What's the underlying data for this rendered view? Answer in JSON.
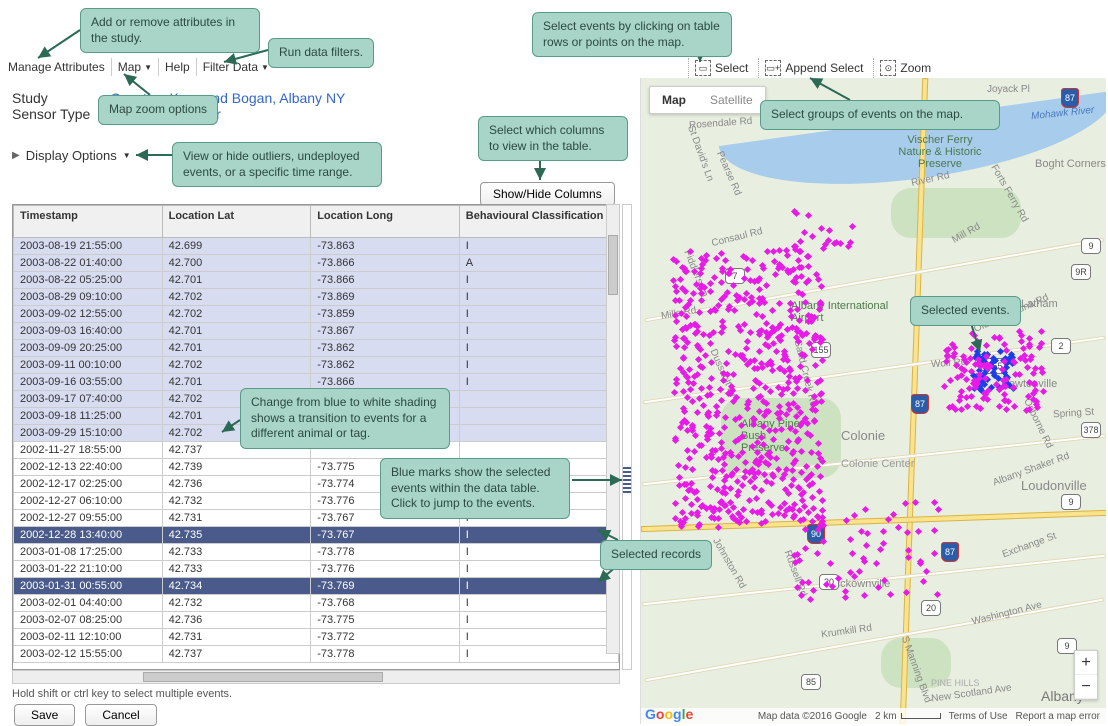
{
  "callouts": {
    "add_remove": "Add or remove attributes in the study.",
    "map_zoom": "Map zoom options",
    "run_filters": "Run data filters.",
    "display_opts": "View or hide outliers, undeployed events, or a specific time range.",
    "select_columns": "Select which columns to view in the table.",
    "shading_change": "Change from blue to white shading shows a transition to events for a different animal or tag.",
    "blue_marks": "Blue marks show the selected events within the data table. Click to jump to the events.",
    "selected_records": "Selected records",
    "select_events": "Select events by clicking on table rows or points on the map.",
    "select_groups": "Select groups of events on the map.",
    "selected_events": "Selected events."
  },
  "menubar": {
    "manage_attributes": "Manage Attributes",
    "map": "Map",
    "help": "Help",
    "filter_data": "Filter Data"
  },
  "study": {
    "label_study": "Study",
    "label_sensor": "Sensor Type",
    "value_study": "Coyotes, Kays and Bogan, Albany NY",
    "value_sensor": "Radio Transmitter"
  },
  "display_options": "Display Options",
  "showhide": "Show/Hide Columns",
  "columns": {
    "timestamp": "Timestamp",
    "lat": "Location Lat",
    "long": "Location Long",
    "behav": "Behavioural Classification"
  },
  "rows": [
    {
      "ts": "2003-08-19 21:55:00",
      "lat": "42.699",
      "lon": "-73.863",
      "b": "I",
      "shade": true
    },
    {
      "ts": "2003-08-22 01:40:00",
      "lat": "42.700",
      "lon": "-73.866",
      "b": "A",
      "shade": true
    },
    {
      "ts": "2003-08-22 05:25:00",
      "lat": "42.701",
      "lon": "-73.866",
      "b": "I",
      "shade": true
    },
    {
      "ts": "2003-08-29 09:10:00",
      "lat": "42.702",
      "lon": "-73.869",
      "b": "I",
      "shade": true
    },
    {
      "ts": "2003-09-02 12:55:00",
      "lat": "42.702",
      "lon": "-73.859",
      "b": "I",
      "shade": true
    },
    {
      "ts": "2003-09-03 16:40:00",
      "lat": "42.701",
      "lon": "-73.867",
      "b": "I",
      "shade": true
    },
    {
      "ts": "2003-09-09 20:25:00",
      "lat": "42.701",
      "lon": "-73.862",
      "b": "I",
      "shade": true
    },
    {
      "ts": "2003-09-11 00:10:00",
      "lat": "42.702",
      "lon": "-73.862",
      "b": "I",
      "shade": true
    },
    {
      "ts": "2003-09-16 03:55:00",
      "lat": "42.701",
      "lon": "-73.866",
      "b": "I",
      "shade": true
    },
    {
      "ts": "2003-09-17 07:40:00",
      "lat": "42.702",
      "lon": "",
      "b": "",
      "shade": true
    },
    {
      "ts": "2003-09-18 11:25:00",
      "lat": "42.701",
      "lon": "",
      "b": "",
      "shade": true
    },
    {
      "ts": "2003-09-29 15:10:00",
      "lat": "42.702",
      "lon": "",
      "b": "",
      "shade": true
    },
    {
      "ts": "2002-11-27 18:55:00",
      "lat": "42.737",
      "lon": "",
      "b": "",
      "shade": false
    },
    {
      "ts": "2002-12-13 22:40:00",
      "lat": "42.739",
      "lon": "-73.775",
      "b": "",
      "shade": false
    },
    {
      "ts": "2002-12-17 02:25:00",
      "lat": "42.736",
      "lon": "-73.774",
      "b": "",
      "shade": false
    },
    {
      "ts": "2002-12-27 06:10:00",
      "lat": "42.732",
      "lon": "-73.776",
      "b": "I",
      "shade": false
    },
    {
      "ts": "2002-12-27 09:55:00",
      "lat": "42.731",
      "lon": "-73.767",
      "b": "I",
      "shade": false
    },
    {
      "ts": "2002-12-28 13:40:00",
      "lat": "42.735",
      "lon": "-73.767",
      "b": "I",
      "shade": false,
      "selected": true
    },
    {
      "ts": "2003-01-08 17:25:00",
      "lat": "42.733",
      "lon": "-73.778",
      "b": "I",
      "shade": false
    },
    {
      "ts": "2003-01-22 21:10:00",
      "lat": "42.733",
      "lon": "-73.776",
      "b": "I",
      "shade": false
    },
    {
      "ts": "2003-01-31 00:55:00",
      "lat": "42.734",
      "lon": "-73.769",
      "b": "I",
      "shade": false,
      "selected": true
    },
    {
      "ts": "2003-02-01 04:40:00",
      "lat": "42.732",
      "lon": "-73.768",
      "b": "I",
      "shade": false
    },
    {
      "ts": "2003-02-07 08:25:00",
      "lat": "42.736",
      "lon": "-73.775",
      "b": "I",
      "shade": false
    },
    {
      "ts": "2003-02-11 12:10:00",
      "lat": "42.731",
      "lon": "-73.772",
      "b": "I",
      "shade": false
    },
    {
      "ts": "2003-02-12 15:55:00",
      "lat": "42.737",
      "lon": "-73.778",
      "b": "I",
      "shade": false
    }
  ],
  "hint": "Hold shift or ctrl key to select multiple events.",
  "buttons": {
    "save": "Save",
    "cancel": "Cancel"
  },
  "maptools": {
    "select": "Select",
    "append": "Append Select",
    "zoom": "Zoom"
  },
  "maptype": {
    "map": "Map",
    "sat": "Satellite"
  },
  "map_labels": {
    "vischer": "Vischer Ferry Nature & Historic Preserve",
    "boght": "Boght Corners",
    "airport": "Albany International Airport",
    "colonie": "Colonie",
    "coloniectr": "Colonie Center",
    "mckown": "Mckownville",
    "loudon": "Loudonville",
    "newton": "Newtonville",
    "albany": "Albany",
    "pinehills": "PINE HILLS",
    "latham": "Latham",
    "bushpine": "Albany Pine Bush Preserve",
    "rd1": "Rosendale Rd",
    "rd2": "Consaul Rd",
    "rd3": "Wolf Rd",
    "rd4": "Albany Shaker Rd",
    "rd5": "Exchange St",
    "rd6": "Washington Ave",
    "rd7": "New Scotland Ave",
    "rd8": "Forts Ferry Rd",
    "rd9": "Mill Rd",
    "rd10": "Old Niskayuna Rd",
    "rd11": "Spring St",
    "rd12": "River Rd",
    "rd13": "Johnston Rd",
    "rd14": "Russell Rd",
    "rd15": "Krumkill Rd",
    "rd16": "S Manning Blvd",
    "rd17": "Pearse Rd",
    "rd18": "St David's Ln",
    "rd19": "Sand Creek Rd",
    "rd20": "Dussault Dr",
    "rd21": "Fiddlers Ln",
    "rd22": "Mohawk River",
    "rd23": "Mills Rd",
    "rd24": "Osborne Rd",
    "rd25": "Joyack Pl"
  },
  "routes": {
    "r7": "7",
    "r9": "9",
    "r2": "2",
    "r378": "378",
    "r20": "20",
    "r85": "85",
    "r155": "155",
    "r87": "87",
    "r90": "90",
    "r9r": "9R"
  },
  "attribution": {
    "mapdata": "Map data ©2016 Google",
    "scale": "2 km",
    "terms": "Terms of Use",
    "report": "Report a map error"
  }
}
